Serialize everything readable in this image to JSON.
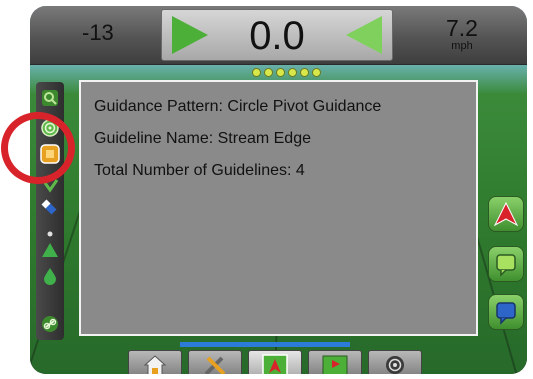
{
  "status": {
    "cross_track": "-13",
    "guidance_value": "0.0",
    "speed_value": "7.2",
    "speed_unit": "mph"
  },
  "info_panel": {
    "line1": "Guidance Pattern: Circle Pivot Guidance",
    "line2": "Guideline Name: Stream Edge",
    "line3": "Total Number of Guidelines: 4"
  },
  "lightbar": {
    "leds_lit": 6
  },
  "left_toolbar": [
    "zoom-icon",
    "circle-pivot-icon",
    "guideline-icon",
    "vehicle-icon",
    "magnet-icon",
    "arrow-up-icon",
    "drop-icon",
    "link-icon"
  ],
  "right_toolbar": [
    "guidance-mode-icon",
    "mark-a-icon",
    "mark-b-icon"
  ],
  "bottom_tabs": [
    "home-icon",
    "tools-icon",
    "guidance-icon",
    "map-icon",
    "target-icon"
  ],
  "colors": {
    "highlight": "#d9232b",
    "accent_green": "#4caf38",
    "panel_gray": "#8a8a8a"
  }
}
